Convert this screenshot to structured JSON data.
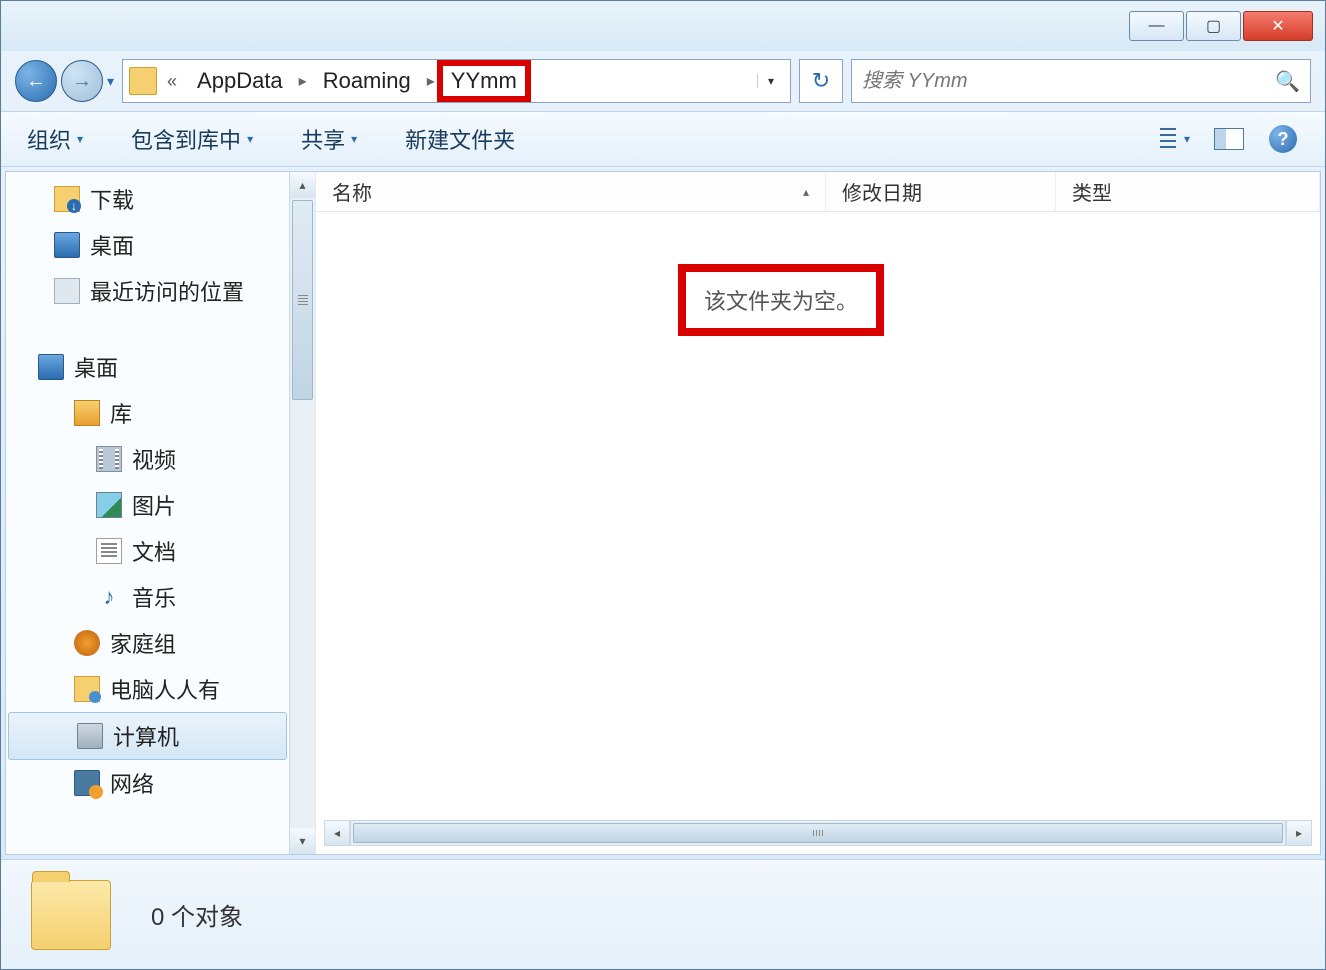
{
  "titlebar": {
    "minimize": "—",
    "maximize": "▢",
    "close": "✕"
  },
  "address": {
    "overflow": "«",
    "crumbs": [
      "AppData",
      "Roaming",
      "YYmm"
    ],
    "sep": "▸",
    "drop": "▾",
    "refresh": "↻"
  },
  "search": {
    "placeholder": "搜索 YYmm",
    "icon": "🔍"
  },
  "toolbar": {
    "organize": "组织",
    "include": "包含到库中",
    "share": "共享",
    "newfolder": "新建文件夹",
    "drop": "▾"
  },
  "sidebar": {
    "downloads": "下载",
    "desktop_fav": "桌面",
    "recent": "最近访问的位置",
    "desktop": "桌面",
    "libraries": "库",
    "videos": "视频",
    "pictures": "图片",
    "documents": "文档",
    "music": "音乐",
    "homegroup": "家庭组",
    "user": "电脑人人有",
    "computer": "计算机",
    "network": "网络"
  },
  "columns": {
    "name": "名称",
    "date": "修改日期",
    "type": "类型",
    "sort": "▴"
  },
  "empty": "该文件夹为空。",
  "status": {
    "count": "0 个对象"
  },
  "help": "?"
}
